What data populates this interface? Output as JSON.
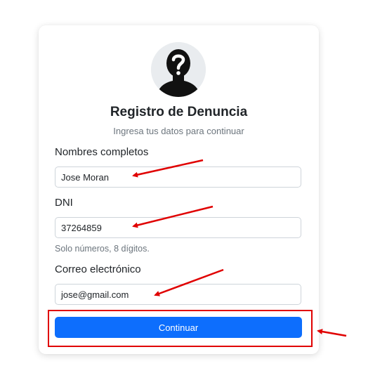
{
  "form": {
    "title": "Registro de Denuncia",
    "subtitle": "Ingresa tus datos para continuar",
    "name_label": "Nombres completos",
    "name_value": "Jose Moran",
    "dni_label": "DNI",
    "dni_value": "37264859",
    "dni_hint": "Solo números, 8 dígitos.",
    "email_label": "Correo electrónico",
    "email_value": "jose@gmail.com",
    "submit_label": "Continuar"
  },
  "icons": {
    "avatar": "anonymous-user-icon"
  },
  "colors": {
    "primary": "#0d6efd",
    "annotation": "#e00000"
  }
}
